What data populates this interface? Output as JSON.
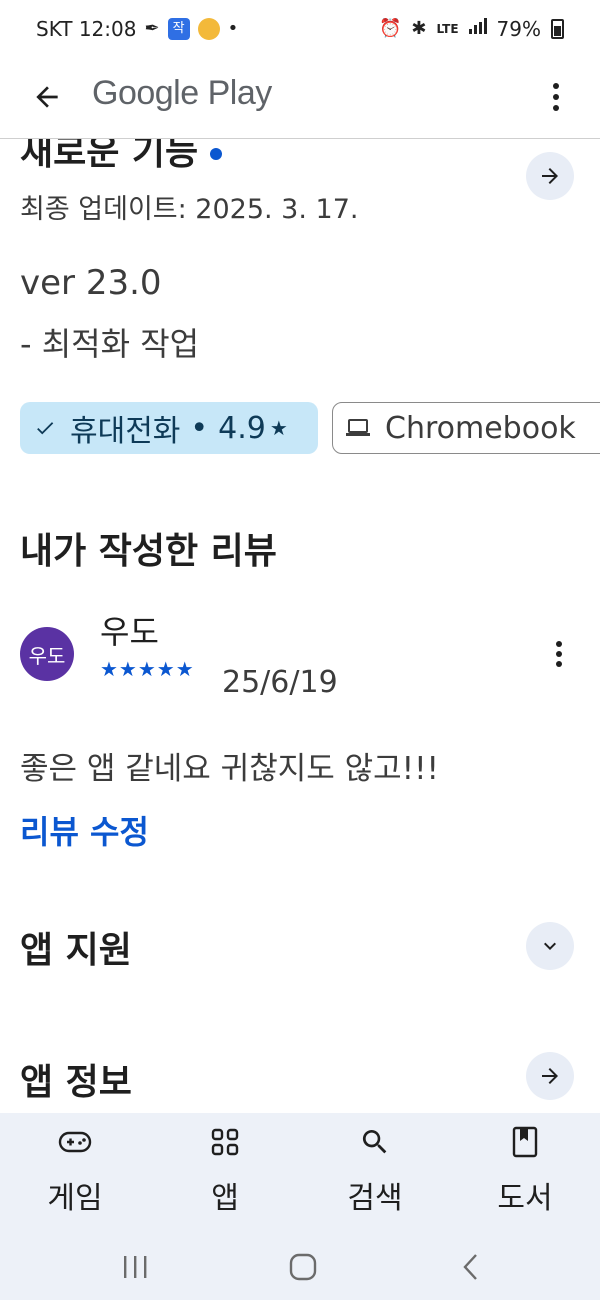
{
  "status_bar": {
    "carrier_time": "SKT 12:08",
    "badge_text": "작",
    "network": "LTE",
    "battery": "79%"
  },
  "app_bar": {
    "title": "Google Play"
  },
  "whats_new": {
    "title": "새로운 기능",
    "updated": "최종 업데이트: 2025. 3. 17.",
    "version": "ver 23.0",
    "note": "- 최적화 작업"
  },
  "device_chips": [
    {
      "label": "휴대전화",
      "rating": "4.9",
      "star": "★",
      "selected": true
    },
    {
      "label": "Chromebook",
      "selected": false
    }
  ],
  "my_review": {
    "heading": "내가 작성한 리뷰",
    "avatar_text": "우도",
    "reviewer": "우도",
    "stars": "★★★★★",
    "rating": 5,
    "date": "25/6/19",
    "text": "좋은 앱 같네요 귀찮지도 않고!!!",
    "edit_label": "리뷰 수정"
  },
  "sections": {
    "app_support": "앱 지원",
    "app_info": "앱 정보"
  },
  "bottom_nav": [
    {
      "label": "게임",
      "icon": "gamepad-icon"
    },
    {
      "label": "앱",
      "icon": "apps-grid-icon"
    },
    {
      "label": "검색",
      "icon": "search-icon"
    },
    {
      "label": "도서",
      "icon": "book-icon"
    }
  ],
  "colors": {
    "accent": "#0b57d0",
    "chip_selected": "#c7e7f8",
    "avatar": "#5a32a3",
    "nav_background": "#edf1f8"
  }
}
